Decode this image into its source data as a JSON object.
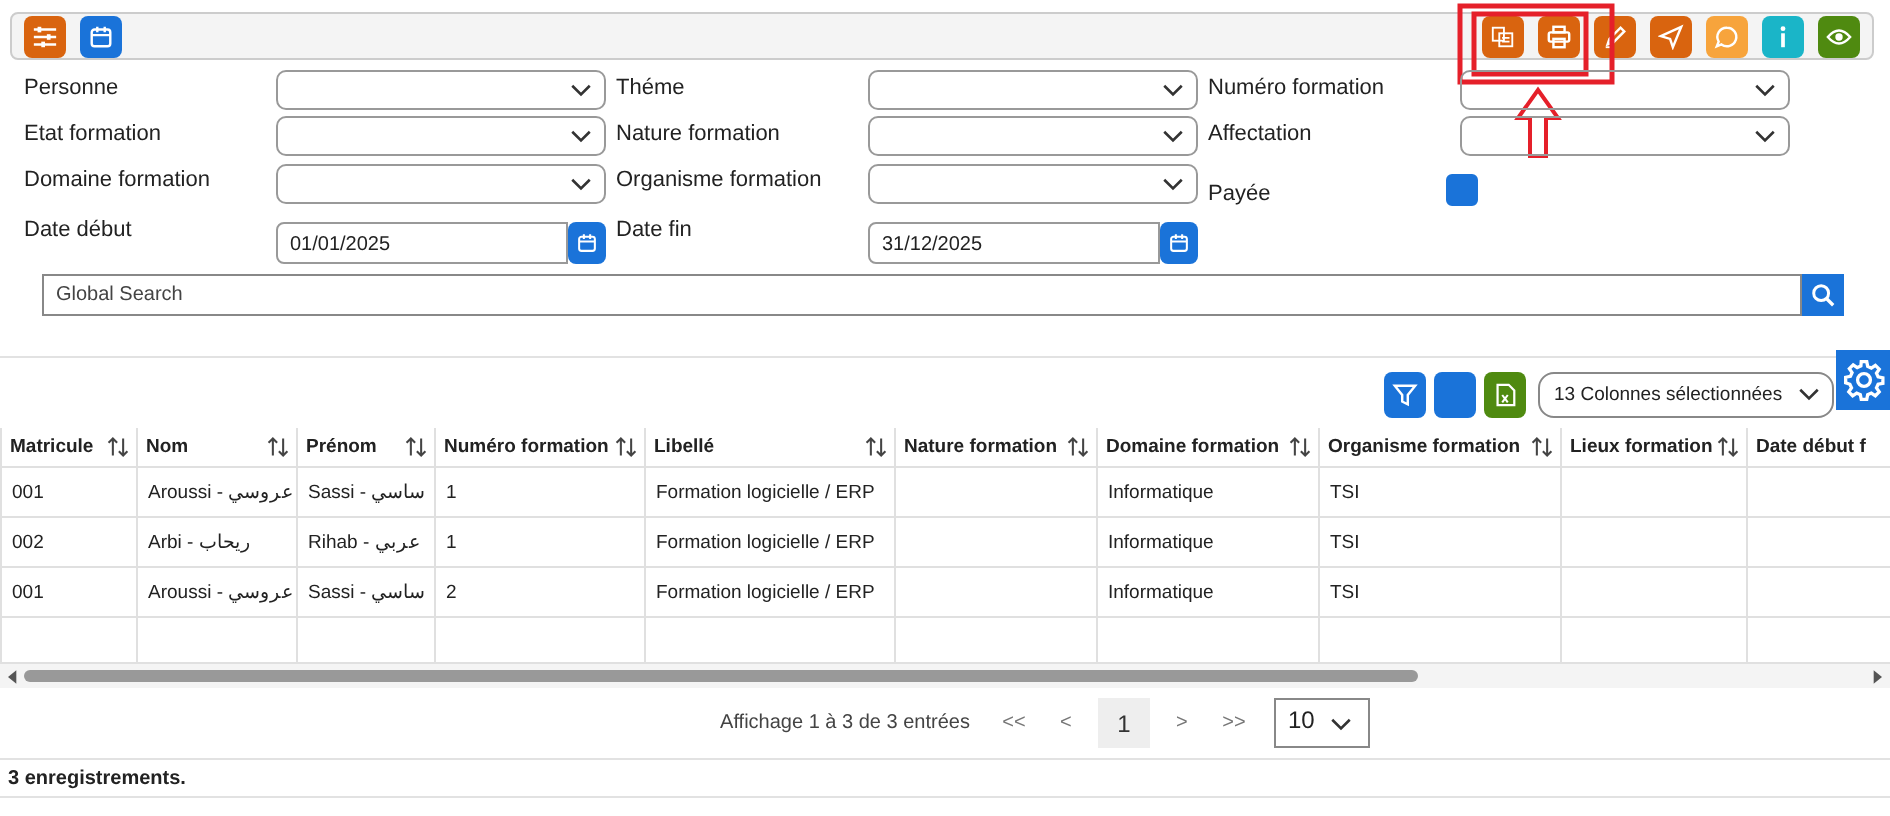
{
  "toolbar": {
    "left_buttons": [
      {
        "kind": "sliders",
        "color": "#d9640f"
      },
      {
        "kind": "calendar",
        "color": "#1a73d9"
      }
    ],
    "right_buttons": [
      {
        "kind": "documents",
        "color": "#d9640f"
      },
      {
        "kind": "print",
        "color": "#d9640f"
      },
      {
        "kind": "pencil",
        "color": "#d9640f"
      },
      {
        "kind": "send",
        "color": "#d9640f"
      },
      {
        "kind": "comment",
        "color": "#f7a43c"
      },
      {
        "kind": "info",
        "color": "#1ab5c8"
      },
      {
        "kind": "eye",
        "color": "#4f8a10"
      }
    ]
  },
  "filters": [
    {
      "label": "Personne",
      "kind": "select"
    },
    {
      "label": "Théme",
      "kind": "select"
    },
    {
      "label": "Numéro formation",
      "kind": "select"
    },
    {
      "label": "Etat formation",
      "kind": "select"
    },
    {
      "label": "Nature formation",
      "kind": "select"
    },
    {
      "label": "Affectation",
      "kind": "select"
    },
    {
      "label": "Domaine formation",
      "kind": "select"
    },
    {
      "label": "Organisme formation",
      "kind": "select"
    },
    {
      "label": "Payée",
      "kind": "checkbox",
      "checked": true
    },
    {
      "label": "Date début",
      "kind": "date",
      "value": "01/01/2025"
    },
    {
      "label": "Date fin",
      "kind": "date",
      "value": "31/12/2025"
    }
  ],
  "search": {
    "placeholder": "Global Search"
  },
  "table_toolbar": {
    "columns_select": "13 Colonnes sélectionnées"
  },
  "table": {
    "columns": [
      "Matricule",
      "Nom",
      "Prénom",
      "Numéro formation",
      "Libellé",
      "Nature formation",
      "Domaine formation",
      "Organisme formation",
      "Lieux formation",
      "Date début f"
    ],
    "rows": [
      [
        "001",
        "Aroussi - عروسي",
        "Sassi - ساسي",
        "1",
        "Formation logicielle / ERP",
        "",
        "Informatique",
        "TSI",
        "",
        ""
      ],
      [
        "002",
        "Arbi - ريحاب",
        "Rihab - عربي",
        "1",
        "Formation logicielle / ERP",
        "",
        "Informatique",
        "TSI",
        "",
        ""
      ],
      [
        "001",
        "Aroussi - عروسي",
        "Sassi - ساسي",
        "2",
        "Formation logicielle / ERP",
        "",
        "Informatique",
        "TSI",
        "",
        ""
      ]
    ]
  },
  "pagination": {
    "info": "Affichage 1 à 3 de 3 entrées",
    "first": "<<",
    "prev": "<",
    "pages": [
      {
        "label": "1",
        "selected": true
      }
    ],
    "next": ">",
    "last": ">>",
    "page_size": "10"
  },
  "footer": "3 enregistrements."
}
